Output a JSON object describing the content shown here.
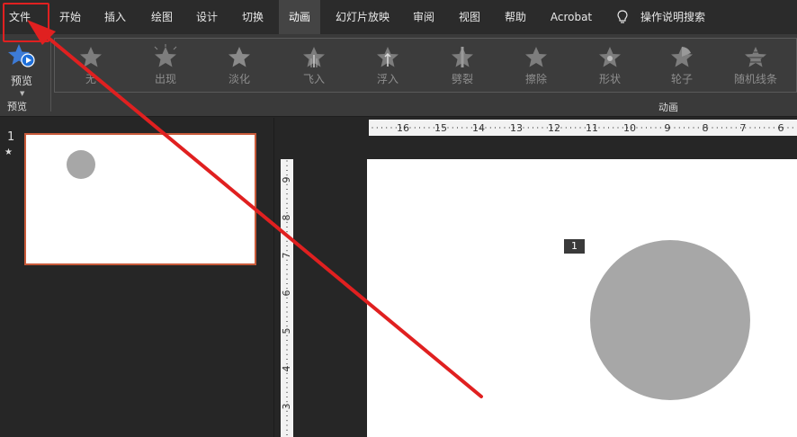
{
  "tabs": {
    "file": "文件",
    "home": "开始",
    "insert": "插入",
    "draw": "绘图",
    "design": "设计",
    "transitions": "切换",
    "animations": "动画",
    "slideshow": "幻灯片放映",
    "review": "审阅",
    "view": "视图",
    "help": "帮助",
    "acrobat": "Acrobat"
  },
  "tell_me": "操作说明搜索",
  "ribbon": {
    "preview_label": "预览",
    "preview_group": "预览",
    "animation_group": "动画",
    "effects": [
      "无",
      "出现",
      "淡化",
      "飞入",
      "浮入",
      "劈裂",
      "擦除",
      "形状",
      "轮子",
      "随机线条"
    ]
  },
  "thumbnails": {
    "slide_number": "1",
    "star": "★"
  },
  "slide": {
    "animation_tag": "1"
  },
  "rulers": {
    "horizontal": [
      "16",
      "15",
      "14",
      "13",
      "12",
      "11",
      "10",
      "9",
      "8",
      "7",
      "6"
    ],
    "vertical": [
      "9",
      "8",
      "7",
      "6",
      "5",
      "4",
      "3"
    ]
  },
  "colors": {
    "accent": "#e02020",
    "active_tab": "#444444",
    "thumb_border": "#c85a3a",
    "shape_fill": "#a7a7a7"
  }
}
